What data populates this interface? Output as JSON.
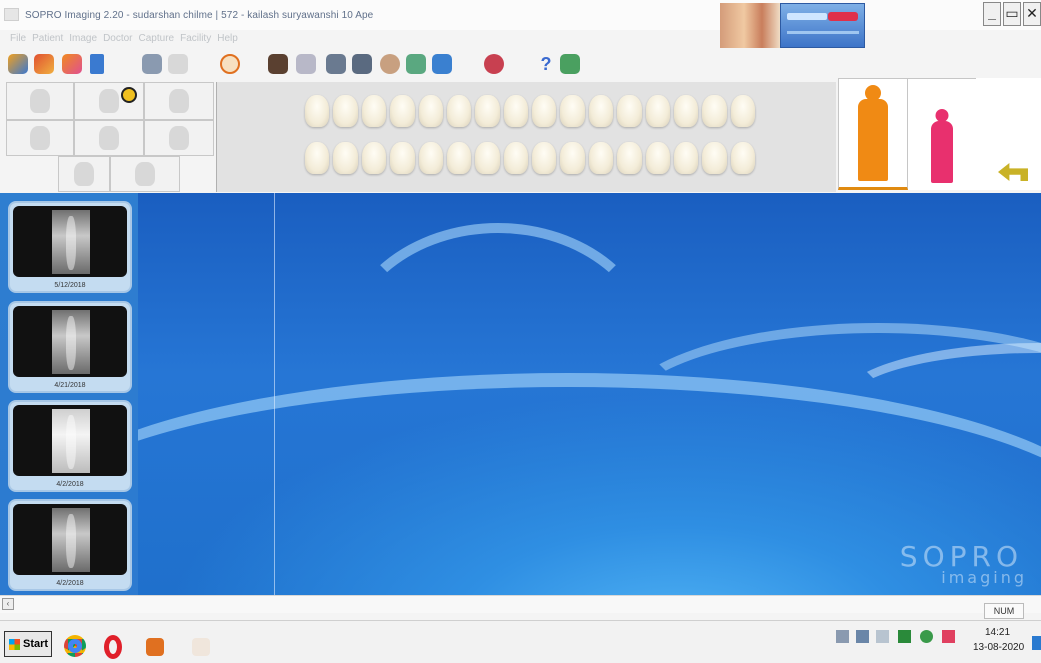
{
  "window": {
    "title": "SOPRO Imaging 2.20 -  sudarshan chilme | 572 -  kailash suryawanshi 10 Ape",
    "controls": [
      "minimize-icon",
      "restore-icon",
      "close-icon"
    ]
  },
  "menu": {
    "items": [
      "File",
      "Patient",
      "Image",
      "Doctor",
      "Capture",
      "Facility",
      "Help"
    ]
  },
  "toolbar": {
    "icons": [
      "open-patient-icon",
      "patient-heads-icon",
      "patient-swap-icon",
      "add-patient-icon",
      "print-icon",
      "document-icon",
      "target-icon",
      "tooth-view-icon",
      "periodontal-icon",
      "camera-icon",
      "cd-export-icon",
      "settings-wheel-icon",
      "flash-icon",
      "arrow-export-icon",
      "radiation-icon",
      "help-icon",
      "info-icon"
    ]
  },
  "xray_thumbnails": [
    {
      "date": "5/12/2018",
      "tone": "dark"
    },
    {
      "date": "4/21/2018",
      "tone": "dark"
    },
    {
      "date": "4/2/2018",
      "tone": "light"
    },
    {
      "date": "4/2/2018",
      "tone": "dark"
    }
  ],
  "patient_type": {
    "adult_color": "#f08a14",
    "child_color": "#e8306e",
    "back_icon_color": "#c9b227"
  },
  "brand": {
    "line1": "SOPRO",
    "line2": "imaging"
  },
  "status_bar": {
    "num_lock": "NUM"
  },
  "taskbar": {
    "start_label": "Start",
    "apps": [
      "chrome-icon",
      "opera-icon",
      "outlook-icon",
      "sopro-icon"
    ],
    "time": "14:21",
    "date": "13-08-2020"
  },
  "colors": {
    "workspace_blue": "#2676d5",
    "thumb_panel_blue": "#2c7ad0"
  }
}
